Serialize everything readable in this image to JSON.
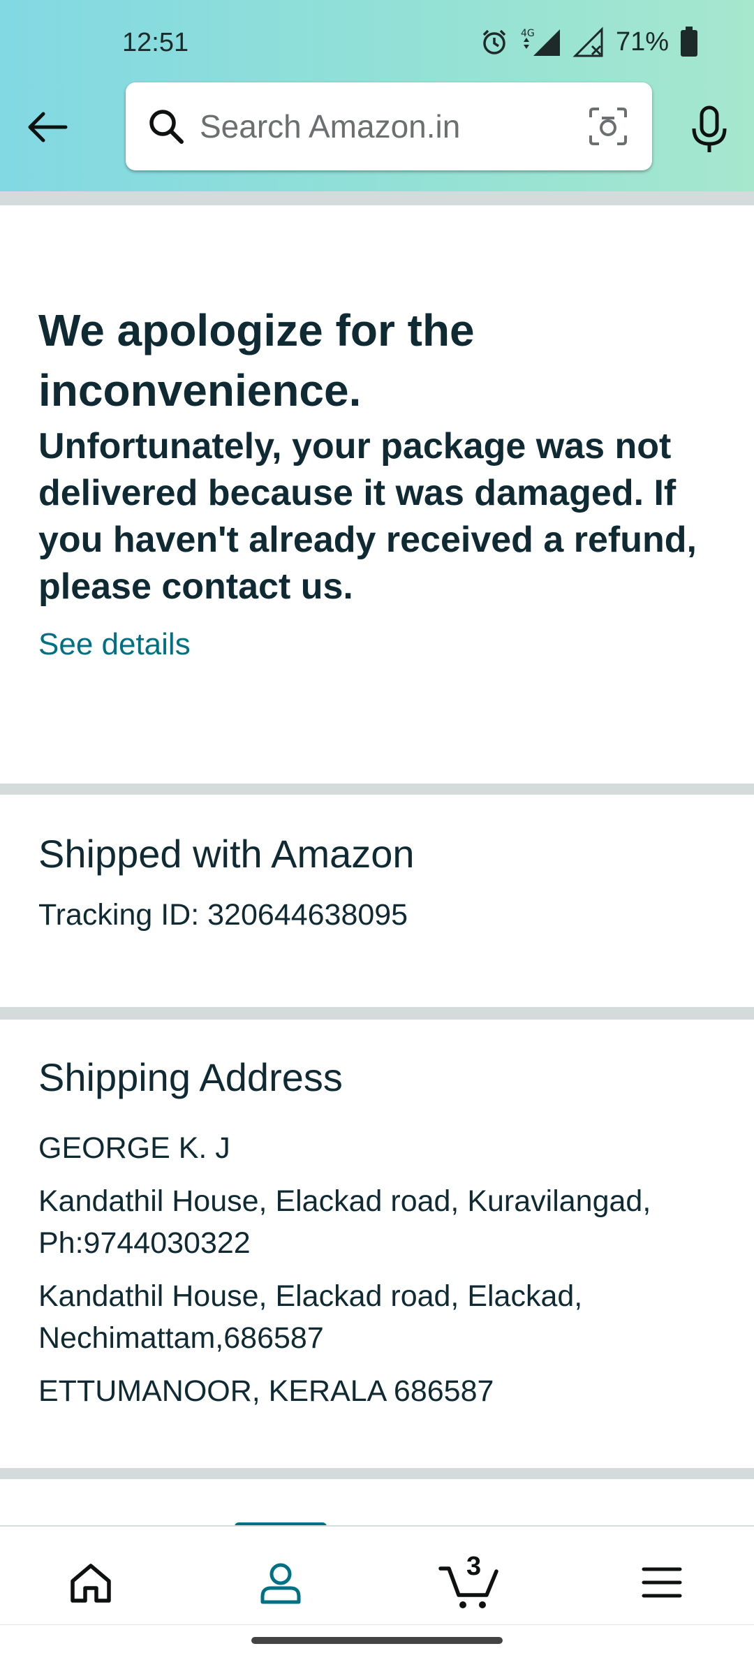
{
  "status_bar": {
    "time": "12:51",
    "network": "4G",
    "battery": "71%"
  },
  "search": {
    "placeholder": "Search Amazon.in"
  },
  "notice": {
    "heading": "We apologize for the inconvenience.",
    "message": "Unfortunately, your package was not delivered because it was damaged. If you haven't already received a refund, please contact us.",
    "link": "See details"
  },
  "shipment": {
    "title": "Shipped with Amazon",
    "tracking": "Tracking ID: 320644638095"
  },
  "address": {
    "title": "Shipping Address",
    "name": "GEORGE K. J",
    "line1": "Kandathil House, Elackad road, Kuravilangad, Ph:9744030322",
    "line2": "Kandathil House, Elackad road, Elackad, Nechimattam,686587",
    "line3": "ETTUMANOOR, KERALA 686587"
  },
  "bottom_nav": {
    "cart_count": "3",
    "active": "account"
  },
  "colors": {
    "accent": "#007185",
    "heading_text": "#0f2a33",
    "divider": "#d5dbdb"
  }
}
